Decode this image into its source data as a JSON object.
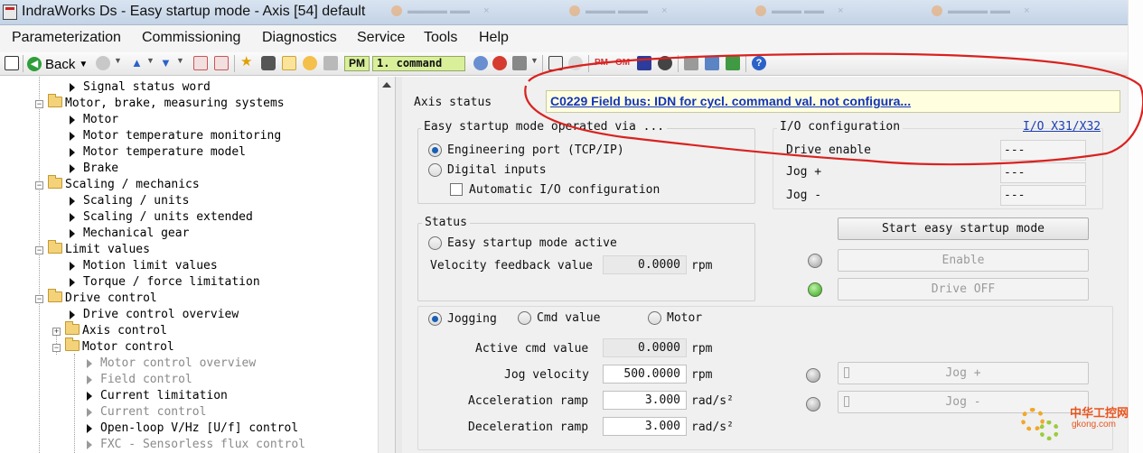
{
  "window": {
    "title": "IndraWorks Ds - Easy startup mode - Axis [54] default"
  },
  "menu": [
    "Parameterization",
    "Commissioning",
    "Diagnostics",
    "Service",
    "Tools",
    "Help"
  ],
  "toolbar": {
    "back_label": "Back",
    "pm_label": "PM",
    "command_label": "1. command"
  },
  "tree": [
    {
      "label": "Signal status word",
      "kind": "leaf",
      "level": 2,
      "grey": false
    },
    {
      "label": "Motor, brake, measuring systems",
      "kind": "folder",
      "level": 1,
      "expanded": true
    },
    {
      "label": "Motor",
      "kind": "leaf",
      "level": 2,
      "grey": false
    },
    {
      "label": "Motor temperature monitoring",
      "kind": "leaf",
      "level": 2,
      "grey": false
    },
    {
      "label": "Motor temperature model",
      "kind": "leaf",
      "level": 2,
      "grey": false
    },
    {
      "label": "Brake",
      "kind": "leaf",
      "level": 2,
      "grey": false
    },
    {
      "label": "Scaling / mechanics",
      "kind": "folder",
      "level": 1,
      "expanded": true
    },
    {
      "label": "Scaling / units",
      "kind": "leaf",
      "level": 2,
      "grey": false
    },
    {
      "label": "Scaling / units extended",
      "kind": "leaf",
      "level": 2,
      "grey": false
    },
    {
      "label": "Mechanical gear",
      "kind": "leaf",
      "level": 2,
      "grey": false
    },
    {
      "label": "Limit values",
      "kind": "folder",
      "level": 1,
      "expanded": true
    },
    {
      "label": "Motion limit values",
      "kind": "leaf",
      "level": 2,
      "grey": false
    },
    {
      "label": "Torque / force limitation",
      "kind": "leaf",
      "level": 2,
      "grey": false
    },
    {
      "label": "Drive control",
      "kind": "folder",
      "level": 1,
      "expanded": true
    },
    {
      "label": "Drive control overview",
      "kind": "leaf",
      "level": 2,
      "grey": false
    },
    {
      "label": "Axis control",
      "kind": "folder",
      "level": 2,
      "expanded": false
    },
    {
      "label": "Motor control",
      "kind": "folder",
      "level": 2,
      "expanded": true
    },
    {
      "label": "Motor control overview",
      "kind": "leaf",
      "level": 3,
      "grey": true
    },
    {
      "label": "Field control",
      "kind": "leaf",
      "level": 3,
      "grey": true
    },
    {
      "label": "Current limitation",
      "kind": "leaf",
      "level": 3,
      "grey": false
    },
    {
      "label": "Current control",
      "kind": "leaf",
      "level": 3,
      "grey": true
    },
    {
      "label": "Open-loop V/Hz [U/f] control",
      "kind": "leaf",
      "level": 3,
      "grey": false
    },
    {
      "label": "FXC - Sensorless flux control",
      "kind": "leaf",
      "level": 3,
      "grey": true
    }
  ],
  "axis_status": {
    "label": "Axis status",
    "message": "C0229 Field bus: IDN for cycl. command val. not configura..."
  },
  "operated_via": {
    "title": "Easy startup mode operated via ...",
    "engineering_port": "Engineering port (TCP/IP)",
    "digital_inputs": "Digital inputs",
    "auto_io": "Automatic I/O configuration",
    "selected": "engineering_port"
  },
  "io_config": {
    "title": "I/O configuration",
    "link": "I/O X31/X32",
    "drive_enable_label": "Drive enable",
    "drive_enable_value": "---",
    "jog_plus_label": "Jog +",
    "jog_plus_value": "---",
    "jog_minus_label": "Jog -",
    "jog_minus_value": "---"
  },
  "status": {
    "title": "Status",
    "active_label": "Easy startup mode active",
    "vel_label": "Velocity feedback value",
    "vel_value": "0.0000",
    "vel_unit": "rpm"
  },
  "buttons": {
    "start": "Start easy startup mode",
    "enable": "Enable",
    "drive_off": "Drive OFF",
    "jog_plus": "Jog +",
    "jog_minus": "Jog -"
  },
  "leds": {
    "enable": "grey",
    "drive_off": "green",
    "jog_plus": "grey",
    "jog_minus": "grey"
  },
  "mode": {
    "jogging": "Jogging",
    "cmd_value": "Cmd value",
    "motor": "Motor",
    "selected": "jogging"
  },
  "params": {
    "active_cmd_label": "Active cmd value",
    "active_cmd_value": "0.0000",
    "active_cmd_unit": "rpm",
    "jog_vel_label": "Jog velocity",
    "jog_vel_value": "500.0000",
    "jog_vel_unit": "rpm",
    "accel_label": "Acceleration ramp",
    "accel_value": "3.000",
    "accel_unit": "rad/s²",
    "decel_label": "Deceleration ramp",
    "decel_value": "3.000",
    "decel_unit": "rad/s²"
  },
  "watermark": {
    "text": "中华工控网",
    "url": "gkong.com"
  },
  "colors": {
    "annotation": "#d9221f",
    "link": "#1c3fb5",
    "message_bg": "#ffffe0"
  }
}
